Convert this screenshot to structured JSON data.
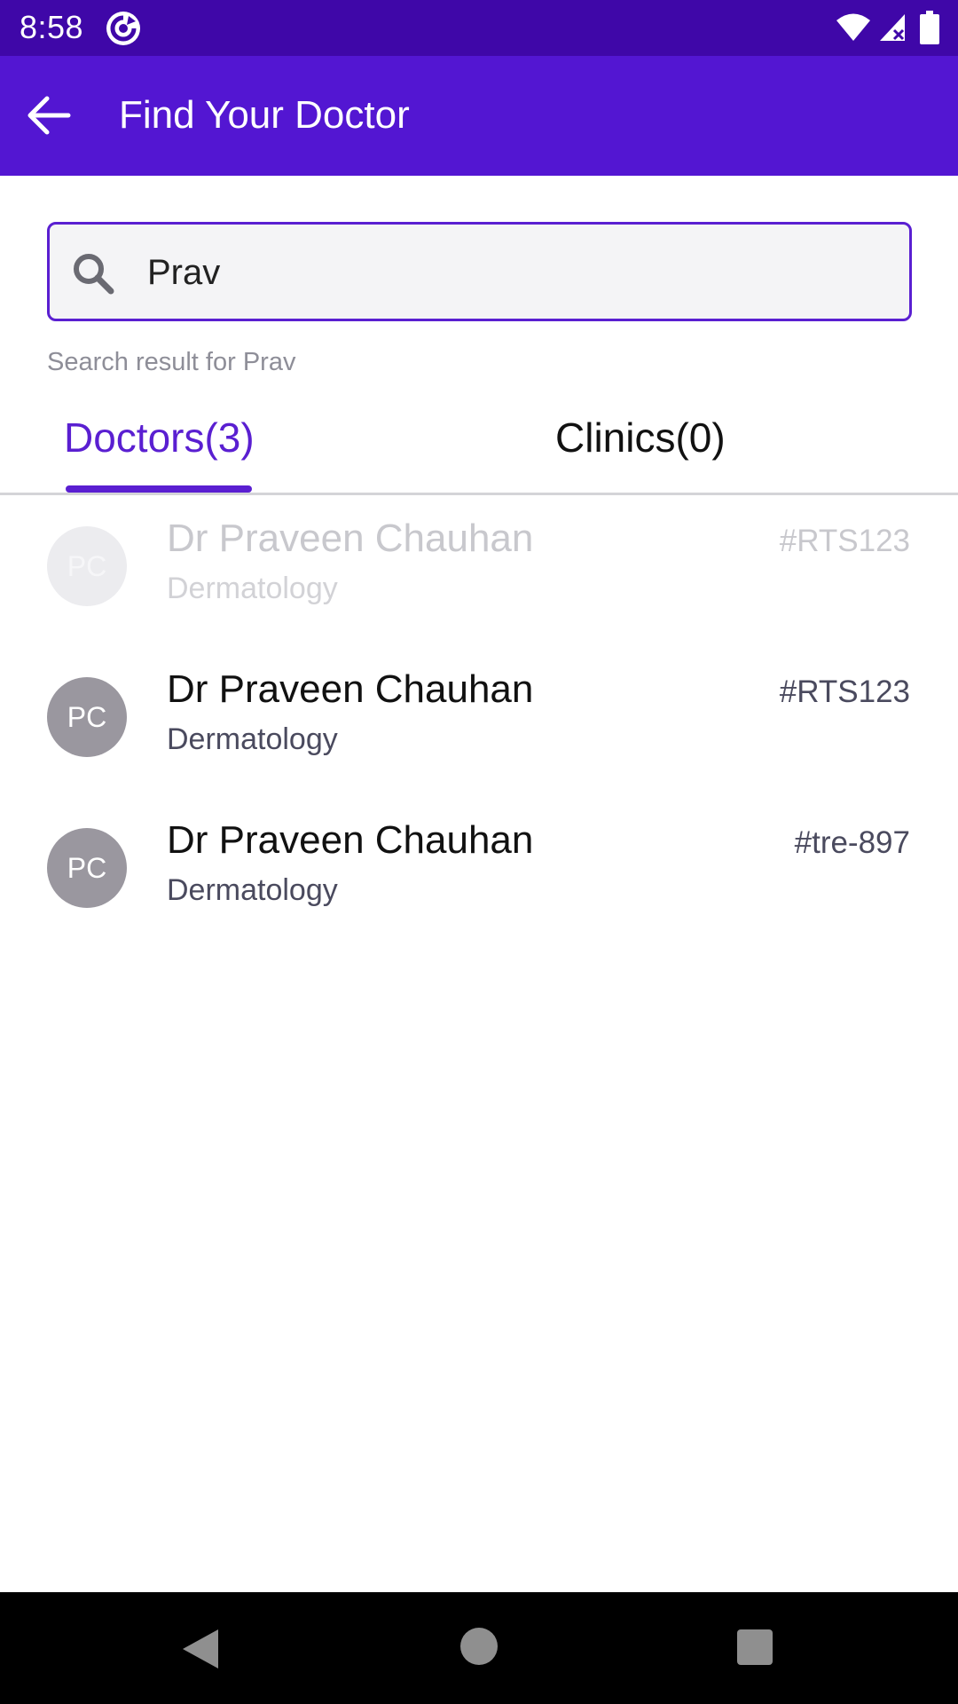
{
  "status_bar": {
    "time": "8:58",
    "icons": [
      "app-sync-icon",
      "wifi-icon",
      "signal-icon",
      "battery-icon"
    ]
  },
  "app_bar": {
    "back_icon": "arrow-left-icon",
    "title": "Find Your Doctor"
  },
  "search": {
    "value": "Prav",
    "placeholder": "",
    "icon": "search-icon",
    "result_caption": "Search result for Prav"
  },
  "tabs": [
    {
      "label": "Doctors(3)",
      "active": true
    },
    {
      "label": "Clinics(0)",
      "active": false
    }
  ],
  "doctors": [
    {
      "initials": "PC",
      "name": "Dr Praveen Chauhan",
      "specialty": "Dermatology",
      "code": "#RTS123",
      "faded": true
    },
    {
      "initials": "PC",
      "name": "Dr Praveen Chauhan",
      "specialty": "Dermatology",
      "code": "#RTS123",
      "faded": false
    },
    {
      "initials": "PC",
      "name": "Dr Praveen Chauhan",
      "specialty": "Dermatology",
      "code": "#tre-897",
      "faded": false
    }
  ],
  "nav_bar": {
    "icons": [
      "nav-back-icon",
      "nav-home-icon",
      "nav-recents-icon"
    ]
  },
  "colors": {
    "status_bar": "#3f07a8",
    "app_bar": "#5316d2",
    "accent": "#5a1fd1",
    "avatar": "#9a979f"
  }
}
